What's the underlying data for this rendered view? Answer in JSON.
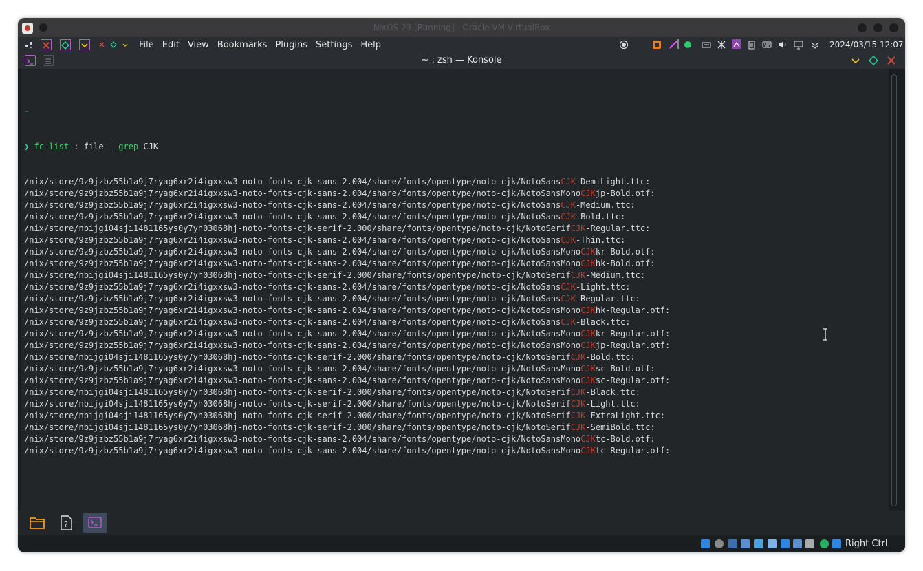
{
  "vm": {
    "title": "NixOS 23 [Running] - Oracle VM VirtualBox"
  },
  "panel": {
    "menu": [
      "File",
      "Edit",
      "View",
      "Bookmarks",
      "Plugins",
      "Settings",
      "Help"
    ],
    "datetime": "2024/03/15  12:07"
  },
  "konsole": {
    "title": "~ : zsh — Konsole"
  },
  "terminal": {
    "prompt_tilde": "~",
    "prompt_symbol": "❯",
    "command_name": "fc-list",
    "command_args": " : file | ",
    "command_pipe": "grep",
    "command_pattern": " CJK",
    "output": [
      {
        "pre": "/nix/store/9z9jzbz55b1a9j7ryag6xr2i4igxxsw3-noto-fonts-cjk-sans-2.004/share/fonts/opentype/noto-cjk/NotoSans",
        "match": "CJK",
        "post": "-DemiLight.ttc:"
      },
      {
        "pre": "/nix/store/9z9jzbz55b1a9j7ryag6xr2i4igxxsw3-noto-fonts-cjk-sans-2.004/share/fonts/opentype/noto-cjk/NotoSansMono",
        "match": "CJK",
        "post": "jp-Bold.otf:"
      },
      {
        "pre": "/nix/store/9z9jzbz55b1a9j7ryag6xr2i4igxxsw3-noto-fonts-cjk-sans-2.004/share/fonts/opentype/noto-cjk/NotoSans",
        "match": "CJK",
        "post": "-Medium.ttc:"
      },
      {
        "pre": "/nix/store/9z9jzbz55b1a9j7ryag6xr2i4igxxsw3-noto-fonts-cjk-sans-2.004/share/fonts/opentype/noto-cjk/NotoSans",
        "match": "CJK",
        "post": "-Bold.ttc:"
      },
      {
        "pre": "/nix/store/nbijgi04sji1481165ys0y7yh03068hj-noto-fonts-cjk-serif-2.000/share/fonts/opentype/noto-cjk/NotoSerif",
        "match": "CJK",
        "post": "-Regular.ttc:"
      },
      {
        "pre": "/nix/store/9z9jzbz55b1a9j7ryag6xr2i4igxxsw3-noto-fonts-cjk-sans-2.004/share/fonts/opentype/noto-cjk/NotoSans",
        "match": "CJK",
        "post": "-Thin.ttc:"
      },
      {
        "pre": "/nix/store/9z9jzbz55b1a9j7ryag6xr2i4igxxsw3-noto-fonts-cjk-sans-2.004/share/fonts/opentype/noto-cjk/NotoSansMono",
        "match": "CJK",
        "post": "kr-Bold.otf:"
      },
      {
        "pre": "/nix/store/9z9jzbz55b1a9j7ryag6xr2i4igxxsw3-noto-fonts-cjk-sans-2.004/share/fonts/opentype/noto-cjk/NotoSansMono",
        "match": "CJK",
        "post": "hk-Bold.otf:"
      },
      {
        "pre": "/nix/store/nbijgi04sji1481165ys0y7yh03068hj-noto-fonts-cjk-serif-2.000/share/fonts/opentype/noto-cjk/NotoSerif",
        "match": "CJK",
        "post": "-Medium.ttc:"
      },
      {
        "pre": "/nix/store/9z9jzbz55b1a9j7ryag6xr2i4igxxsw3-noto-fonts-cjk-sans-2.004/share/fonts/opentype/noto-cjk/NotoSans",
        "match": "CJK",
        "post": "-Light.ttc:"
      },
      {
        "pre": "/nix/store/9z9jzbz55b1a9j7ryag6xr2i4igxxsw3-noto-fonts-cjk-sans-2.004/share/fonts/opentype/noto-cjk/NotoSans",
        "match": "CJK",
        "post": "-Regular.ttc:"
      },
      {
        "pre": "/nix/store/9z9jzbz55b1a9j7ryag6xr2i4igxxsw3-noto-fonts-cjk-sans-2.004/share/fonts/opentype/noto-cjk/NotoSansMono",
        "match": "CJK",
        "post": "hk-Regular.otf:"
      },
      {
        "pre": "/nix/store/9z9jzbz55b1a9j7ryag6xr2i4igxxsw3-noto-fonts-cjk-sans-2.004/share/fonts/opentype/noto-cjk/NotoSans",
        "match": "CJK",
        "post": "-Black.ttc:"
      },
      {
        "pre": "/nix/store/9z9jzbz55b1a9j7ryag6xr2i4igxxsw3-noto-fonts-cjk-sans-2.004/share/fonts/opentype/noto-cjk/NotoSansMono",
        "match": "CJK",
        "post": "kr-Regular.otf:"
      },
      {
        "pre": "/nix/store/9z9jzbz55b1a9j7ryag6xr2i4igxxsw3-noto-fonts-cjk-sans-2.004/share/fonts/opentype/noto-cjk/NotoSansMono",
        "match": "CJK",
        "post": "jp-Regular.otf:"
      },
      {
        "pre": "/nix/store/nbijgi04sji1481165ys0y7yh03068hj-noto-fonts-cjk-serif-2.000/share/fonts/opentype/noto-cjk/NotoSerif",
        "match": "CJK",
        "post": "-Bold.ttc:"
      },
      {
        "pre": "/nix/store/9z9jzbz55b1a9j7ryag6xr2i4igxxsw3-noto-fonts-cjk-sans-2.004/share/fonts/opentype/noto-cjk/NotoSansMono",
        "match": "CJK",
        "post": "sc-Bold.otf:"
      },
      {
        "pre": "/nix/store/9z9jzbz55b1a9j7ryag6xr2i4igxxsw3-noto-fonts-cjk-sans-2.004/share/fonts/opentype/noto-cjk/NotoSansMono",
        "match": "CJK",
        "post": "sc-Regular.otf:"
      },
      {
        "pre": "/nix/store/nbijgi04sji1481165ys0y7yh03068hj-noto-fonts-cjk-serif-2.000/share/fonts/opentype/noto-cjk/NotoSerif",
        "match": "CJK",
        "post": "-Black.ttc:"
      },
      {
        "pre": "/nix/store/nbijgi04sji1481165ys0y7yh03068hj-noto-fonts-cjk-serif-2.000/share/fonts/opentype/noto-cjk/NotoSerif",
        "match": "CJK",
        "post": "-Light.ttc:"
      },
      {
        "pre": "/nix/store/nbijgi04sji1481165ys0y7yh03068hj-noto-fonts-cjk-serif-2.000/share/fonts/opentype/noto-cjk/NotoSerif",
        "match": "CJK",
        "post": "-ExtraLight.ttc:"
      },
      {
        "pre": "/nix/store/nbijgi04sji1481165ys0y7yh03068hj-noto-fonts-cjk-serif-2.000/share/fonts/opentype/noto-cjk/NotoSerif",
        "match": "CJK",
        "post": "-SemiBold.ttc:"
      },
      {
        "pre": "/nix/store/9z9jzbz55b1a9j7ryag6xr2i4igxxsw3-noto-fonts-cjk-sans-2.004/share/fonts/opentype/noto-cjk/NotoSansMono",
        "match": "CJK",
        "post": "tc-Bold.otf:"
      },
      {
        "pre": "/nix/store/9z9jzbz55b1a9j7ryag6xr2i4igxxsw3-noto-fonts-cjk-sans-2.004/share/fonts/opentype/noto-cjk/NotoSansMono",
        "match": "CJK",
        "post": "tc-Regular.otf:"
      }
    ]
  },
  "statusbar": {
    "host_key": "Right Ctrl"
  },
  "colors": {
    "prompt": "#1cdc9a",
    "command": "#3fcf6b",
    "match": "#c0392b",
    "accent": "#b05cc8"
  }
}
